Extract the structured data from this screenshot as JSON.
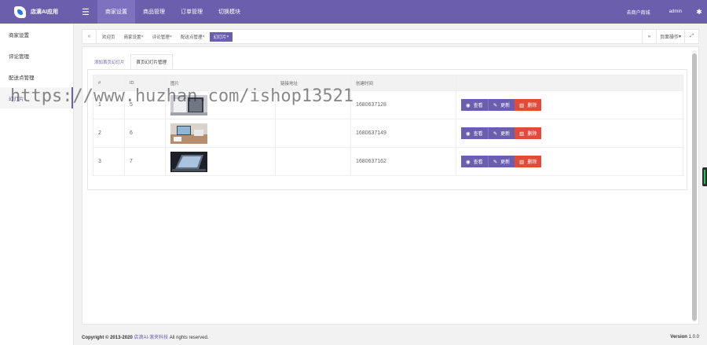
{
  "app": {
    "title": "店滴AI应用"
  },
  "topnav": [
    {
      "label": "商家设置",
      "active": true
    },
    {
      "label": "商品管理",
      "active": false
    },
    {
      "label": "订单管理",
      "active": false
    },
    {
      "label": "切换模块",
      "active": false
    }
  ],
  "topright": {
    "store": "去商户商城",
    "user": "admin"
  },
  "sidebar": [
    {
      "label": "商家设置",
      "active": false
    },
    {
      "label": "评论管理",
      "active": false
    },
    {
      "label": "配送点管理",
      "active": false
    },
    {
      "label": "幻灯片",
      "active": true
    }
  ],
  "tabs": {
    "items": [
      {
        "label": "欢迎页",
        "active": false
      },
      {
        "label": "商家设置",
        "active": false
      },
      {
        "label": "评论管理",
        "active": false
      },
      {
        "label": "配送点管理",
        "active": false
      },
      {
        "label": "幻灯片",
        "active": true
      }
    ],
    "close_glyph": "×",
    "page_ops": "页面操作"
  },
  "subtabs": [
    {
      "label": "添加首页幻灯片",
      "active": false
    },
    {
      "label": "首页幻灯片管理",
      "active": true
    }
  ],
  "table": {
    "headers": [
      "#",
      "ID",
      "图片",
      "链接地址",
      "创建时间",
      ""
    ],
    "rows": [
      {
        "num": "1",
        "id": "5",
        "link": "",
        "time": "1680637128"
      },
      {
        "num": "2",
        "id": "6",
        "link": "",
        "time": "1680637149"
      },
      {
        "num": "3",
        "id": "7",
        "link": "",
        "time": "1680637162"
      }
    ],
    "actions": {
      "view": "查看",
      "edit": "更新",
      "delete": "删除"
    }
  },
  "footer": {
    "prefix": "Copyright © 2013-2020",
    "brand": "店滴AI-滚夹科技",
    "suffix": "All rights reserved.",
    "version_label": "Version",
    "version": "1.0.0"
  },
  "watermark": "https://www.huzhan.com/ishop13521",
  "colors": {
    "accent": "#6b5ead",
    "danger": "#e14b3c"
  }
}
